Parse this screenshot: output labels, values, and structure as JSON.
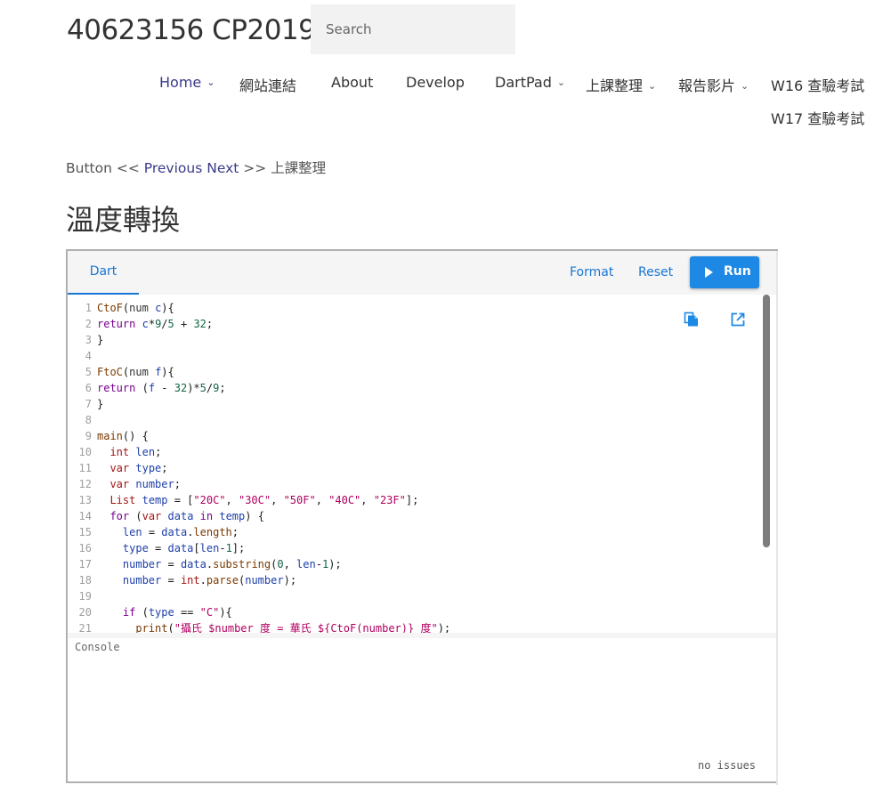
{
  "site": {
    "title": "40623156 CP2019"
  },
  "search": {
    "placeholder": "Search"
  },
  "nav": {
    "items": [
      {
        "label": "Home",
        "dropdown": true,
        "active": true
      },
      {
        "label": "網站連結",
        "dropdown": false
      },
      {
        "label": "About",
        "dropdown": false
      },
      {
        "label": "Develop",
        "dropdown": false
      },
      {
        "label": "DartPad",
        "dropdown": true
      },
      {
        "label": "上課整理",
        "dropdown": true
      },
      {
        "label": "報告影片",
        "dropdown": true
      },
      {
        "label": "W16 查驗考試",
        "dropdown": false
      },
      {
        "label": "W17 查驗考試",
        "dropdown": false
      }
    ]
  },
  "breadcrumb": {
    "prefix": "Button <<",
    "previous": "Previous",
    "next": "Next",
    "suffix": ">> 上課整理"
  },
  "page": {
    "title": "溫度轉換"
  },
  "dartpad": {
    "tab": "Dart",
    "format_label": "Format",
    "reset_label": "Reset",
    "run_label": "Run",
    "console_label": "Console",
    "issues_label": "no issues",
    "accent_color": "#1e88e5",
    "icons": [
      "copy-icon",
      "open-in-new-icon",
      "play-icon"
    ],
    "code_lines": [
      "CtoF(num c){",
      "return c*9/5 + 32;",
      "}",
      "",
      "FtoC(num f){",
      "return (f - 32)*5/9;",
      "}",
      "",
      "main() {",
      "  int len;",
      "  var type;",
      "  var number;",
      "  List temp = [\"20C\", \"30C\", \"50F\", \"40C\", \"23F\"];",
      "  for (var data in temp) {",
      "    len = data.length;",
      "    type = data[len-1];",
      "    number = data.substring(0, len-1);",
      "    number = int.parse(number);",
      "",
      "    if (type == \"C\"){",
      "      print(\"攝氏 $number 度 = 華氏 ${CtoF(number)} 度\");"
    ]
  }
}
